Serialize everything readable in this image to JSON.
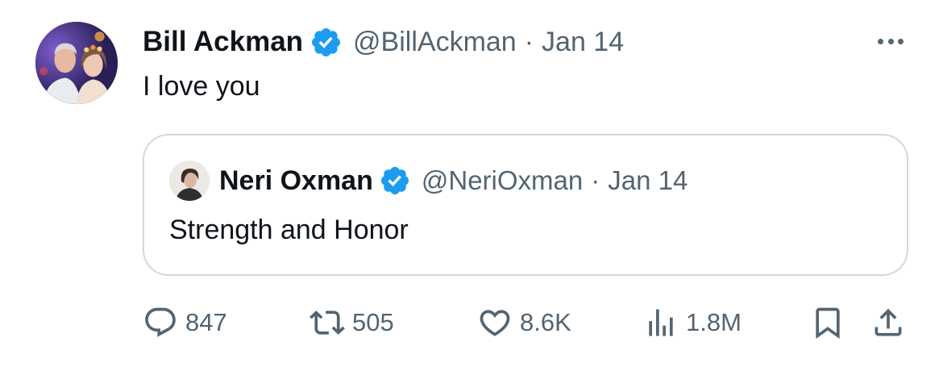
{
  "tweet": {
    "author_name": "Bill Ackman",
    "author_handle": "@BillAckman",
    "separator": "·",
    "date": "Jan 14",
    "text": "I love you",
    "avatar_icon": "profile-photo",
    "verified_icon": "verified-badge-icon",
    "more_icon": "more-options-icon"
  },
  "quoted": {
    "author_name": "Neri Oxman",
    "author_handle": "@NeriOxman",
    "separator": "·",
    "date": "Jan 14",
    "text": "Strength and Honor"
  },
  "actions": {
    "replies": "847",
    "reposts": "505",
    "likes": "8.6K",
    "views": "1.8M"
  },
  "colors": {
    "text_primary": "#0f1419",
    "text_secondary": "#536471",
    "verified_blue": "#1d9bf0",
    "border": "#cfd9de"
  }
}
